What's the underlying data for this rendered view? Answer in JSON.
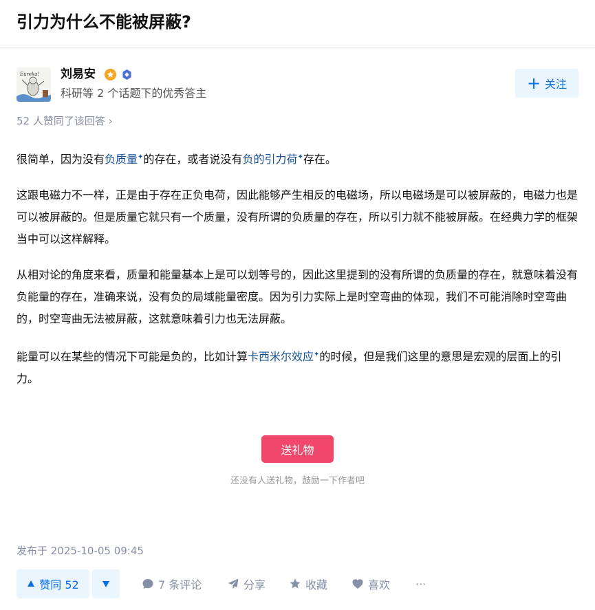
{
  "question": {
    "title": "引力为什么不能被屏蔽?"
  },
  "author": {
    "name": "刘易安",
    "description": "科研等 2 个话题下的优秀答主",
    "follow_label": "关注",
    "avatar_text": "Eureka!"
  },
  "votes_line": "52 人赞同了该回答",
  "content": {
    "p1": {
      "t1": "很简单，因为没有",
      "link1": "负质量",
      "t2": "的存在，或者说没有",
      "link2": "负的引力荷",
      "t3": "存在。"
    },
    "p2": "这跟电磁力不一样，正是由于存在正负电荷，因此能够产生相反的电磁场，所以电磁场是可以被屏蔽的，电磁力也是可以被屏蔽的。但是质量它就只有一个质量，没有所谓的负质量的存在，所以引力就不能被屏蔽。在经典力学的框架当中可以这样解释。",
    "p3": "从相对论的角度来看，质量和能量基本上是可以划等号的，因此这里提到的没有所谓的负质量的存在，就意味着没有负能量的存在，准确来说，没有负的局域能量密度。因为引力实际上是时空弯曲的体现，我们不可能消除时空弯曲的，时空弯曲无法被屏蔽，这就意味着引力也无法屏蔽。",
    "p4": {
      "t1": "能量可以在某些的情况下可能是负的，比如计算",
      "link1": "卡西米尔效应",
      "t2": "的时候，但是我们这里的意思是宏观的层面上的引力。"
    },
    "spark": "✦"
  },
  "gift": {
    "button_label": "送礼物",
    "hint": "还没有人送礼物，鼓励一下作者吧"
  },
  "publish_time": "发布于 2025-10-05 09:45",
  "actions": {
    "vote_up": "赞同 52",
    "comments": "7 条评论",
    "share": "分享",
    "collect": "收藏",
    "like": "喜欢",
    "more": "···"
  },
  "colors": {
    "accent": "#056de8",
    "link": "#175199",
    "gift": "#f1476b",
    "muted": "#8590a6"
  }
}
